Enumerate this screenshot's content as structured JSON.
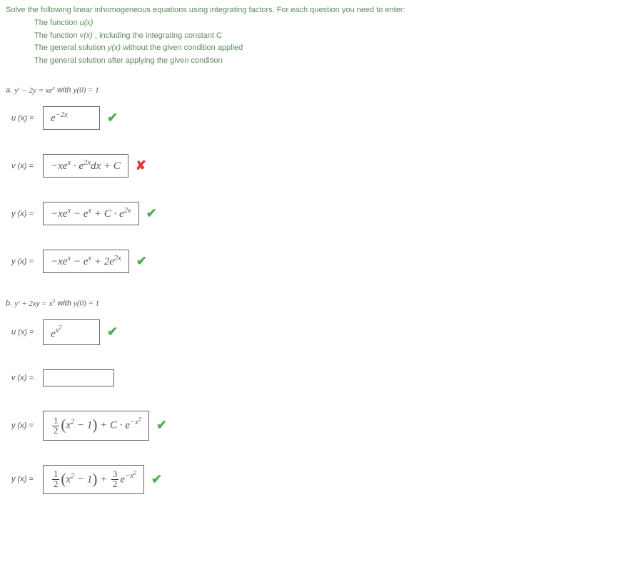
{
  "intro": "Solve the following linear inhomogeneous equations using integrating factors. For each question you need to enter:",
  "given": {
    "line1_a": "The function  ",
    "line1_b": "u(x)",
    "line2_a": "The function  ",
    "line2_b": "v(x)",
    "line2_c": " , including the integrating constant C",
    "line3_a": "The general solution  ",
    "line3_b": "y(x)",
    "line3_c": "  without the given condition applied",
    "line4": "The general solution after applying the given condition"
  },
  "a": {
    "head_a": "a. ",
    "head_b": "y' − 2y = xe",
    "head_exp": "x",
    "head_c": "  with  ",
    "head_d": "y(0) = 1",
    "r1": {
      "label": "u (x) =",
      "ans_base": "e",
      "ans_exp": "−2x",
      "mark": "correct"
    },
    "r2": {
      "label": "v (x) =",
      "ans": "−xe^x · e^{2x} dx + C",
      "mark": "wrong"
    },
    "r3": {
      "label": "y (x) =",
      "ans": "−xe^x − e^x + C · e^{2x}",
      "mark": "correct"
    },
    "r4": {
      "label": "y (x) =",
      "ans": "−xe^x − e^x + 2e^{2x}",
      "mark": "correct"
    }
  },
  "b": {
    "head_a": "b. ",
    "head_b": "y' + 2xy = x",
    "head_exp": "3",
    "head_c": "  with  ",
    "head_d": "y(0) = 1",
    "r1": {
      "label": "u (x) =",
      "ans_base": "e",
      "ans_exp": "x^2",
      "mark": "correct"
    },
    "r2": {
      "label": "v (x) =",
      "ans": "",
      "mark": ""
    },
    "r3": {
      "label": "y (x) =",
      "ans": "½(x² − 1) + C · e^{−x²}",
      "mark": "correct"
    },
    "r4": {
      "label": "y (x) =",
      "ans": "½(x² − 1) + (3/2)e^{−x²}",
      "mark": "correct"
    }
  }
}
